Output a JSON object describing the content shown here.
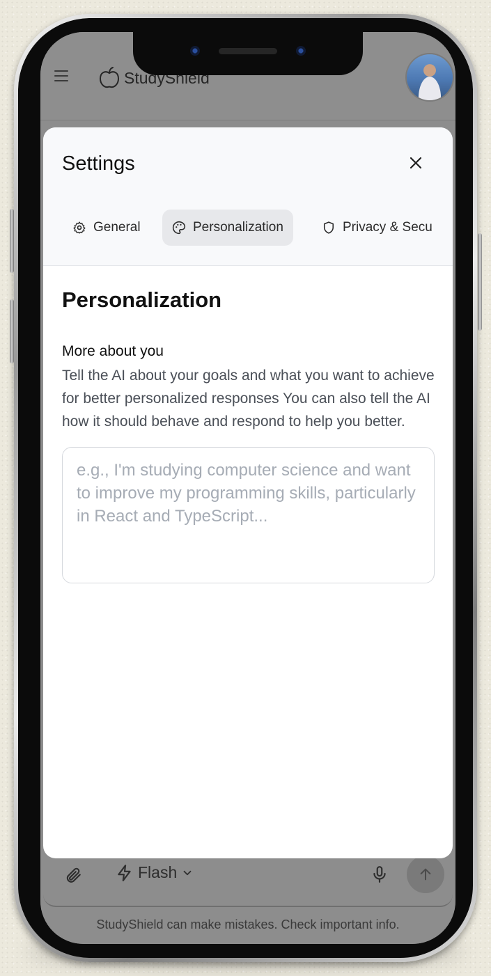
{
  "app": {
    "brand_name": "StudyShield"
  },
  "composer": {
    "model_label": "Flash",
    "disclaimer": "StudyShield can make mistakes. Check important info."
  },
  "settings": {
    "title": "Settings",
    "tabs": [
      {
        "label": "General",
        "icon": "gear-icon",
        "active": false
      },
      {
        "label": "Personalization",
        "icon": "palette-icon",
        "active": true
      },
      {
        "label": "Privacy & Secu",
        "icon": "shield-icon",
        "active": false
      }
    ],
    "section_title": "Personalization",
    "field_label": "More about you",
    "field_description": "Tell the AI about your goals and what you want to achieve for better personalized responses You can also tell the AI how it should behave and respond to help you better.",
    "field_value": "",
    "field_placeholder": "e.g., I'm studying computer science and want to improve my programming skills, particularly in React and TypeScript..."
  },
  "colors": {
    "overlay_dim": "#8d8d8d",
    "modal_bg": "#ffffff",
    "header_bg": "#f8f9fb",
    "active_tab_bg": "#e7e8eb",
    "placeholder": "#a6acb5"
  }
}
